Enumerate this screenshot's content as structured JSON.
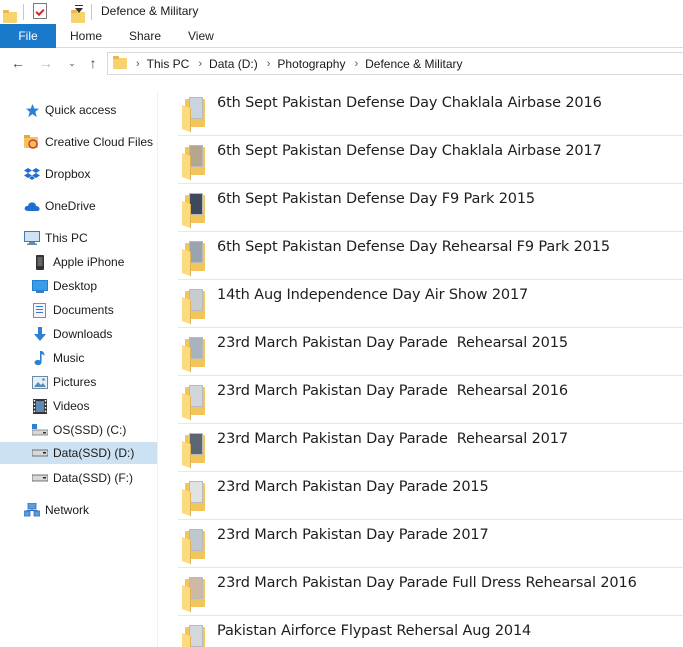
{
  "window": {
    "title": "Defence & Military"
  },
  "ribbon": {
    "tabs": [
      {
        "label": "File",
        "active": true
      },
      {
        "label": "Home"
      },
      {
        "label": "Share"
      },
      {
        "label": "View"
      }
    ]
  },
  "address": {
    "breadcrumbs": [
      "This PC",
      "Data (D:)",
      "Photography",
      "Defence & Military"
    ]
  },
  "sidebar": {
    "items": [
      {
        "label": "Quick access",
        "icon": "star-icon"
      },
      {
        "label": "Creative Cloud Files",
        "icon": "creative-cloud-icon"
      },
      {
        "label": "Dropbox",
        "icon": "dropbox-icon"
      },
      {
        "label": "OneDrive",
        "icon": "onedrive-icon"
      },
      {
        "label": "This PC",
        "icon": "computer-icon"
      },
      {
        "label": "Apple iPhone",
        "icon": "phone-icon"
      },
      {
        "label": "Desktop",
        "icon": "desktop-icon"
      },
      {
        "label": "Documents",
        "icon": "documents-icon"
      },
      {
        "label": "Downloads",
        "icon": "download-arrow-icon"
      },
      {
        "label": "Music",
        "icon": "music-note-icon"
      },
      {
        "label": "Pictures",
        "icon": "pictures-icon"
      },
      {
        "label": "Videos",
        "icon": "film-icon"
      },
      {
        "label": "OS(SSD) (C:)",
        "icon": "drive-windows-icon"
      },
      {
        "label": "Data(SSD) (D:)",
        "icon": "drive-icon",
        "selected": true
      },
      {
        "label": "Data(SSD) (F:)",
        "icon": "drive-icon"
      },
      {
        "label": "Network",
        "icon": "network-icon"
      }
    ]
  },
  "files": [
    {
      "name": "6th Sept Pakistan Defense Day Chaklala Airbase 2016"
    },
    {
      "name": "6th Sept Pakistan Defense Day Chaklala Airbase 2017"
    },
    {
      "name": "6th Sept Pakistan Defense Day F9 Park 2015"
    },
    {
      "name": "6th Sept Pakistan Defense Day Rehearsal F9 Park 2015"
    },
    {
      "name": "14th Aug Independence Day Air Show 2017"
    },
    {
      "name": "23rd March Pakistan Day Parade  Rehearsal 2015"
    },
    {
      "name": "23rd March Pakistan Day Parade  Rehearsal 2016"
    },
    {
      "name": "23rd March Pakistan Day Parade  Rehearsal 2017"
    },
    {
      "name": "23rd March Pakistan Day Parade 2015"
    },
    {
      "name": "23rd March Pakistan Day Parade 2017"
    },
    {
      "name": "23rd March Pakistan Day Parade Full Dress Rehearsal 2016"
    },
    {
      "name": "Pakistan Airforce Flypast Rehersal Aug 2014"
    }
  ],
  "colors": {
    "accent": "#1979ca",
    "selected_bg": "#cce1f2",
    "folder": "#f2c65a"
  }
}
